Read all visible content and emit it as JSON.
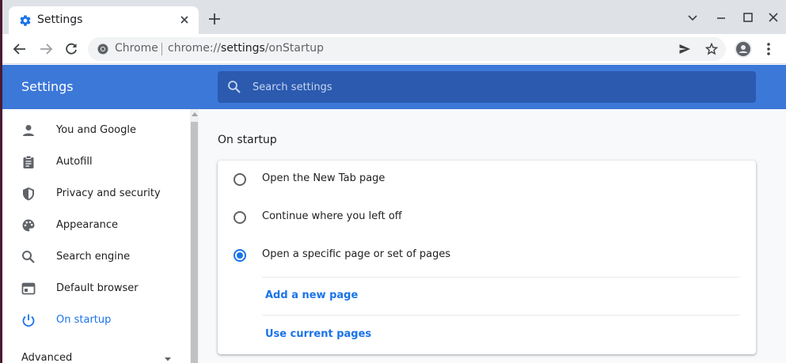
{
  "window": {
    "tab_title": "Settings"
  },
  "toolbar": {
    "site_label": "Chrome",
    "url_scheme": "chrome://",
    "url_host": "settings",
    "url_path": "/onStartup"
  },
  "header": {
    "title": "Settings",
    "search_placeholder": "Search settings"
  },
  "sidebar": {
    "items": [
      {
        "label": "You and Google",
        "icon": "person-icon"
      },
      {
        "label": "Autofill",
        "icon": "clipboard-icon"
      },
      {
        "label": "Privacy and security",
        "icon": "shield-icon"
      },
      {
        "label": "Appearance",
        "icon": "palette-icon"
      },
      {
        "label": "Search engine",
        "icon": "search-icon"
      },
      {
        "label": "Default browser",
        "icon": "browser-icon"
      },
      {
        "label": "On startup",
        "icon": "power-icon",
        "active": true
      }
    ],
    "advanced_label": "Advanced"
  },
  "main": {
    "section_title": "On startup",
    "options": [
      {
        "label": "Open the New Tab page",
        "checked": false
      },
      {
        "label": "Continue where you left off",
        "checked": false
      },
      {
        "label": "Open a specific page or set of pages",
        "checked": true
      }
    ],
    "add_page_label": "Add a new page",
    "use_current_label": "Use current pages"
  },
  "colors": {
    "header_blue": "#3c78d8",
    "search_blue": "#2b5aaf",
    "accent": "#1a73e8"
  }
}
